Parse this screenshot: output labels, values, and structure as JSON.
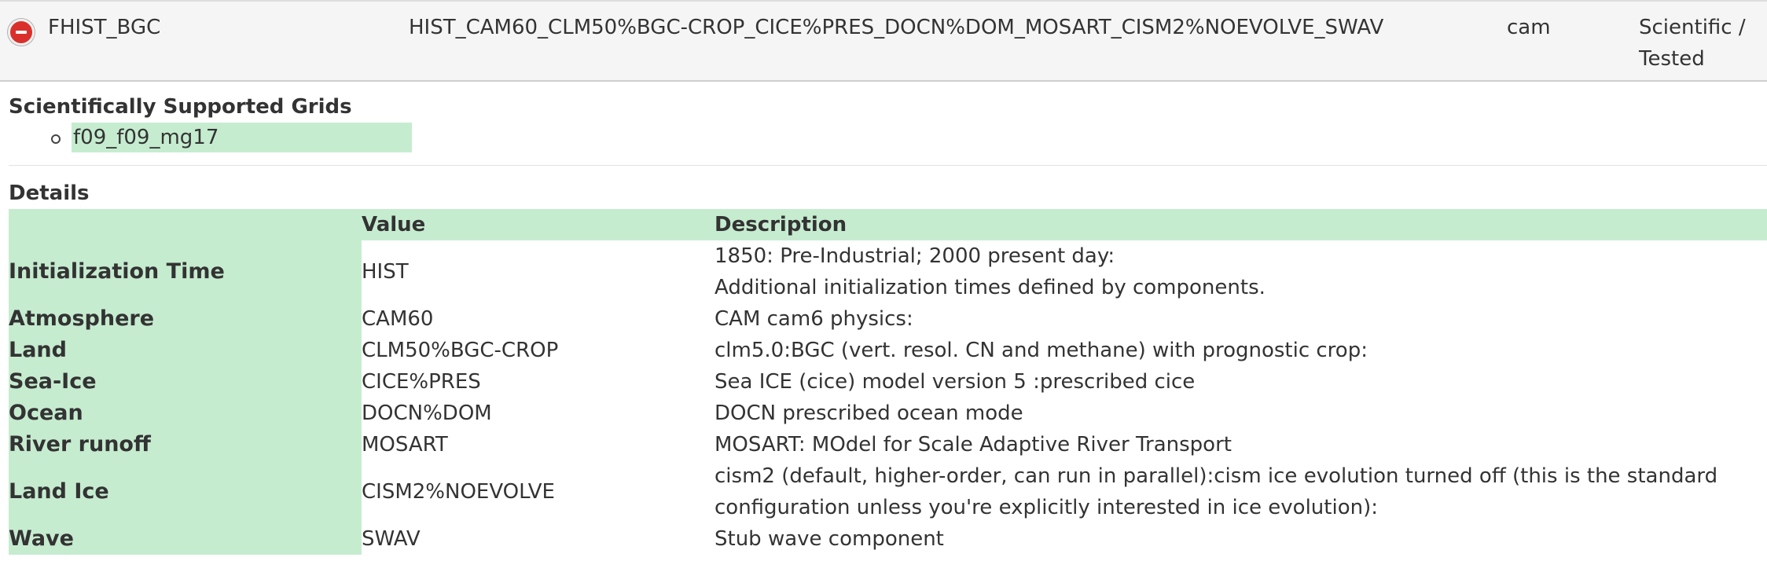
{
  "compset": {
    "name": "FHIST_BGC",
    "longname": "HIST_CAM60_CLM50%BGC-CROP_CICE%PRES_DOCN%DOM_MOSART_CISM2%NOEVOLVE_SWAV",
    "component": "cam",
    "status": "Scientific / Tested"
  },
  "grids": {
    "title": "Scientifically Supported Grids",
    "items": [
      "f09_f09_mg17"
    ]
  },
  "details": {
    "title": "Details",
    "headers": {
      "name": "",
      "value": "Value",
      "description": "Description"
    },
    "rows": [
      {
        "name": "Initialization Time",
        "value": "HIST",
        "description": "1850: Pre-Industrial; 2000 present day:\nAdditional initialization times defined by components."
      },
      {
        "name": "Atmosphere",
        "value": "CAM60",
        "description": "CAM cam6 physics:"
      },
      {
        "name": "Land",
        "value": "CLM50%BGC-CROP",
        "description": "clm5.0:BGC (vert. resol. CN and methane) with prognostic crop:"
      },
      {
        "name": "Sea-Ice",
        "value": "CICE%PRES",
        "description": "Sea ICE (cice) model version 5 :prescribed cice"
      },
      {
        "name": "Ocean",
        "value": "DOCN%DOM",
        "description": "DOCN prescribed ocean mode"
      },
      {
        "name": "River runoff",
        "value": "MOSART",
        "description": "MOSART: MOdel for Scale Adaptive River Transport"
      },
      {
        "name": "Land Ice",
        "value": "CISM2%NOEVOLVE",
        "description": "cism2 (default, higher-order, can run in parallel):cism ice evolution turned off (this is the standard configuration unless you're explicitly interested in ice evolution):"
      },
      {
        "name": "Wave",
        "value": "SWAV",
        "description": "Stub wave component"
      }
    ]
  },
  "colors": {
    "highlight": "#c6ecd0",
    "collapse_button": "#d9302c"
  }
}
